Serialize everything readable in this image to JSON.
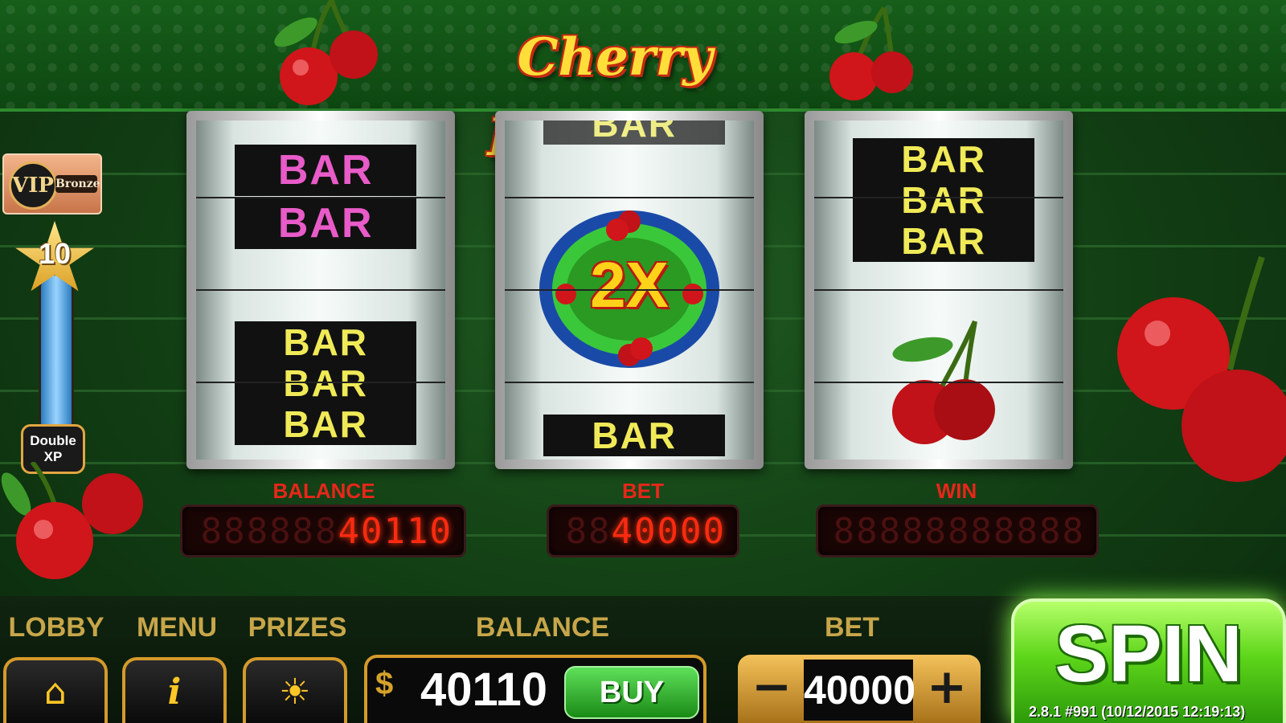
{
  "game": {
    "title": "Cherry Madness",
    "version": "2.8.1 #991",
    "timestamp": "(10/12/2015 12:19:13)"
  },
  "vip": {
    "badge": "VIP",
    "tier": "Bronze"
  },
  "level": {
    "number": "10",
    "double_xp_line1": "Double",
    "double_xp_line2": "XP"
  },
  "reels": [
    {
      "top": "BAR",
      "middle": "BAR",
      "bottom": [
        "BAR",
        "BAR",
        "BAR"
      ]
    },
    {
      "top": "BAR",
      "center": "2X",
      "bottom": "BAR"
    },
    {
      "top": [
        "BAR",
        "BAR",
        "BAR"
      ],
      "center_icon": "cherry-icon"
    }
  ],
  "displays": {
    "balance_label": "BALANCE",
    "balance_ghost": "888888",
    "balance_value": "40110",
    "bet_label": "BET",
    "bet_ghost": "88",
    "bet_value": "40000",
    "win_label": "WIN",
    "win_ghost": "88888888888",
    "win_value": ""
  },
  "bottom_bar": {
    "lobby_label": "LOBBY",
    "menu_label": "MENU",
    "prizes_label": "PRIZES",
    "balance_label": "BALANCE",
    "bet_label": "BET",
    "balance_currency": "$",
    "balance_value": "40110",
    "buy_label": "BUY",
    "bet_minus": "−",
    "bet_value": "40000",
    "bet_plus": "+",
    "spin_label": "SPIN"
  },
  "icons": {
    "lobby": "home-icon",
    "menu": "info-icon",
    "prizes": "sun-icon"
  },
  "colors": {
    "accent_green": "#5ed61a",
    "lcd_red": "#ff2a10",
    "gold": "#d49a2a",
    "bar_yellow": "#f0ea58",
    "bar_pink": "#e85bc8"
  }
}
